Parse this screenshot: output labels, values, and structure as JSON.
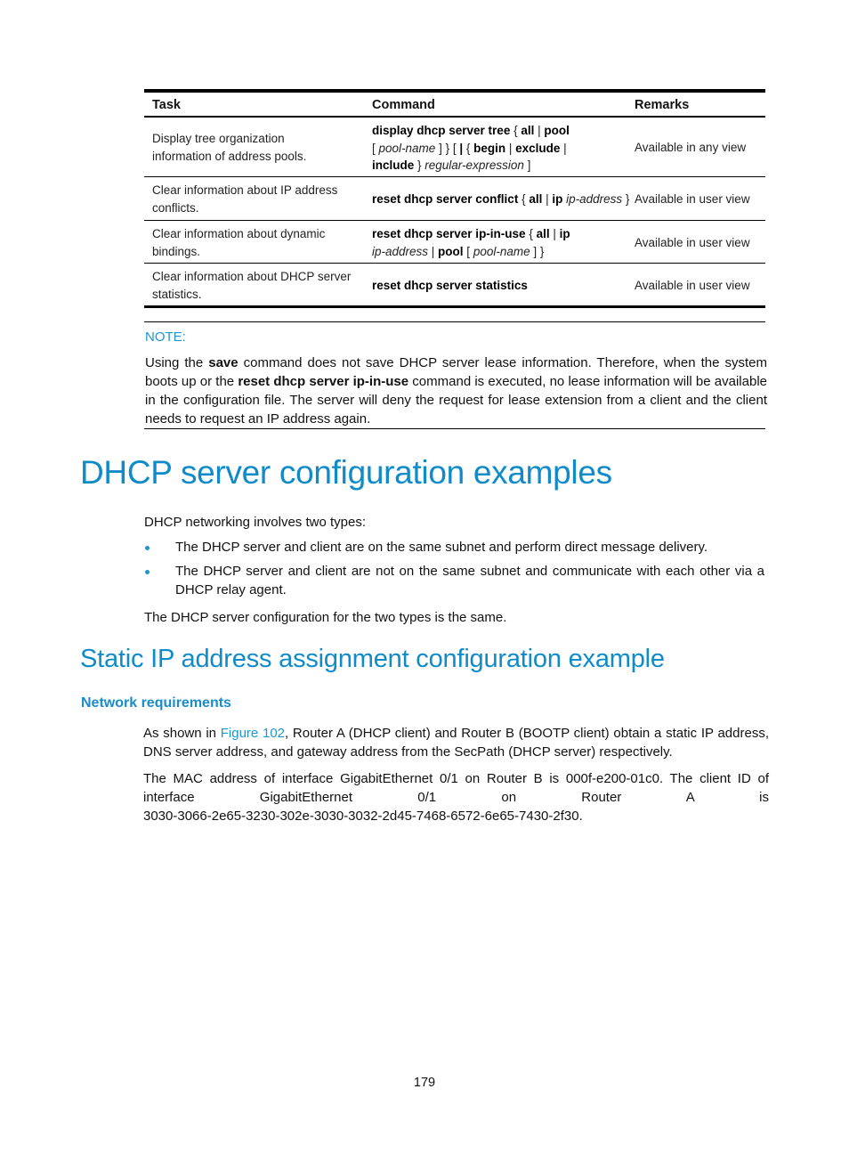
{
  "table": {
    "headers": [
      "Task",
      "Command",
      "Remarks"
    ],
    "rows": [
      {
        "task": [
          "Display tree organization",
          "information of address pools."
        ],
        "command_lines": [
          [
            {
              "t": "display dhcp server tree",
              "s": "b"
            },
            {
              "t": " { ",
              "s": "n"
            },
            {
              "t": "all",
              "s": "b"
            },
            {
              "t": " | ",
              "s": "n"
            },
            {
              "t": "pool",
              "s": "b"
            }
          ],
          [
            {
              "t": "[ ",
              "s": "n"
            },
            {
              "t": "pool-name",
              "s": "i"
            },
            {
              "t": " ] } [ ",
              "s": "n"
            },
            {
              "t": "|",
              "s": "b"
            },
            {
              "t": " { ",
              "s": "n"
            },
            {
              "t": "begin",
              "s": "b"
            },
            {
              "t": " | ",
              "s": "n"
            },
            {
              "t": "exclude",
              "s": "b"
            },
            {
              "t": " |",
              "s": "n"
            }
          ],
          [
            {
              "t": "include",
              "s": "b"
            },
            {
              "t": " } ",
              "s": "n"
            },
            {
              "t": "regular-expression",
              "s": "i"
            },
            {
              "t": " ]",
              "s": "n"
            }
          ]
        ],
        "remarks": "Available in any view"
      },
      {
        "task": [
          "Clear information about IP address",
          "conflicts."
        ],
        "command_lines": [
          [
            {
              "t": "reset dhcp server conflict",
              "s": "b"
            },
            {
              "t": " { ",
              "s": "n"
            },
            {
              "t": "all",
              "s": "b"
            },
            {
              "t": " | ",
              "s": "n"
            },
            {
              "t": "ip",
              "s": "b"
            },
            {
              "t": " ",
              "s": "n"
            },
            {
              "t": "ip-address",
              "s": "i"
            },
            {
              "t": " }",
              "s": "n"
            }
          ]
        ],
        "remarks": "Available in user view"
      },
      {
        "task": [
          "Clear information about dynamic",
          "bindings."
        ],
        "command_lines": [
          [
            {
              "t": "reset dhcp server ip-in-use",
              "s": "b"
            },
            {
              "t": " { ",
              "s": "n"
            },
            {
              "t": "all",
              "s": "b"
            },
            {
              "t": " | ",
              "s": "n"
            },
            {
              "t": "ip",
              "s": "b"
            }
          ],
          [
            {
              "t": "ip-address",
              "s": "i"
            },
            {
              "t": " | ",
              "s": "n"
            },
            {
              "t": "pool",
              "s": "b"
            },
            {
              "t": " [ ",
              "s": "n"
            },
            {
              "t": "pool-name",
              "s": "i"
            },
            {
              "t": " ] }",
              "s": "n"
            }
          ]
        ],
        "remarks": "Available in user view"
      },
      {
        "task": [
          "Clear information about DHCP server",
          "statistics."
        ],
        "command_lines": [
          [
            {
              "t": "reset dhcp server statistics",
              "s": "b"
            }
          ]
        ],
        "remarks": "Available in user view"
      }
    ]
  },
  "note": {
    "label": "NOTE:",
    "body": [
      {
        "t": "Using the ",
        "s": "n"
      },
      {
        "t": "save",
        "s": "b"
      },
      {
        "t": " command does not save DHCP server lease information. Therefore, when the system boots up or the ",
        "s": "n"
      },
      {
        "t": "reset dhcp server ip-in-use",
        "s": "b"
      },
      {
        "t": " command is executed, no lease information will be available in the configuration file. The server will deny the request for lease extension from a client and the client needs to request an IP address again.",
        "s": "n"
      }
    ]
  },
  "section1": {
    "title": "DHCP server configuration examples",
    "intro": "DHCP networking involves two types:",
    "bullets": [
      "The DHCP server and client are on the same subnet and perform direct message delivery.",
      "The DHCP server and client are not on the same subnet and communicate with each other via a DHCP relay agent."
    ],
    "outro": "The DHCP server configuration for the two types is the same."
  },
  "section2": {
    "title": "Static IP address assignment configuration example",
    "subsection": "Network requirements",
    "para1_prefix": "As shown in ",
    "para1_link": "Figure 102",
    "para1_suffix": ", Router A (DHCP client) and Router B (BOOTP client) obtain a static IP address, DNS server address, and gateway address from the SecPath (DHCP server) respectively.",
    "para2_line1": "The MAC address of interface GigabitEthernet 0/1 on Router B is 000f-e200-01c0. The client ID of",
    "para2_line2": "interface GigabitEthernet 0/1 on Router A is",
    "para2_line3": "3030-3066-2e65-3230-302e-3030-3032-2d45-7468-6572-6e65-7430-2f30."
  },
  "page_number": "179"
}
